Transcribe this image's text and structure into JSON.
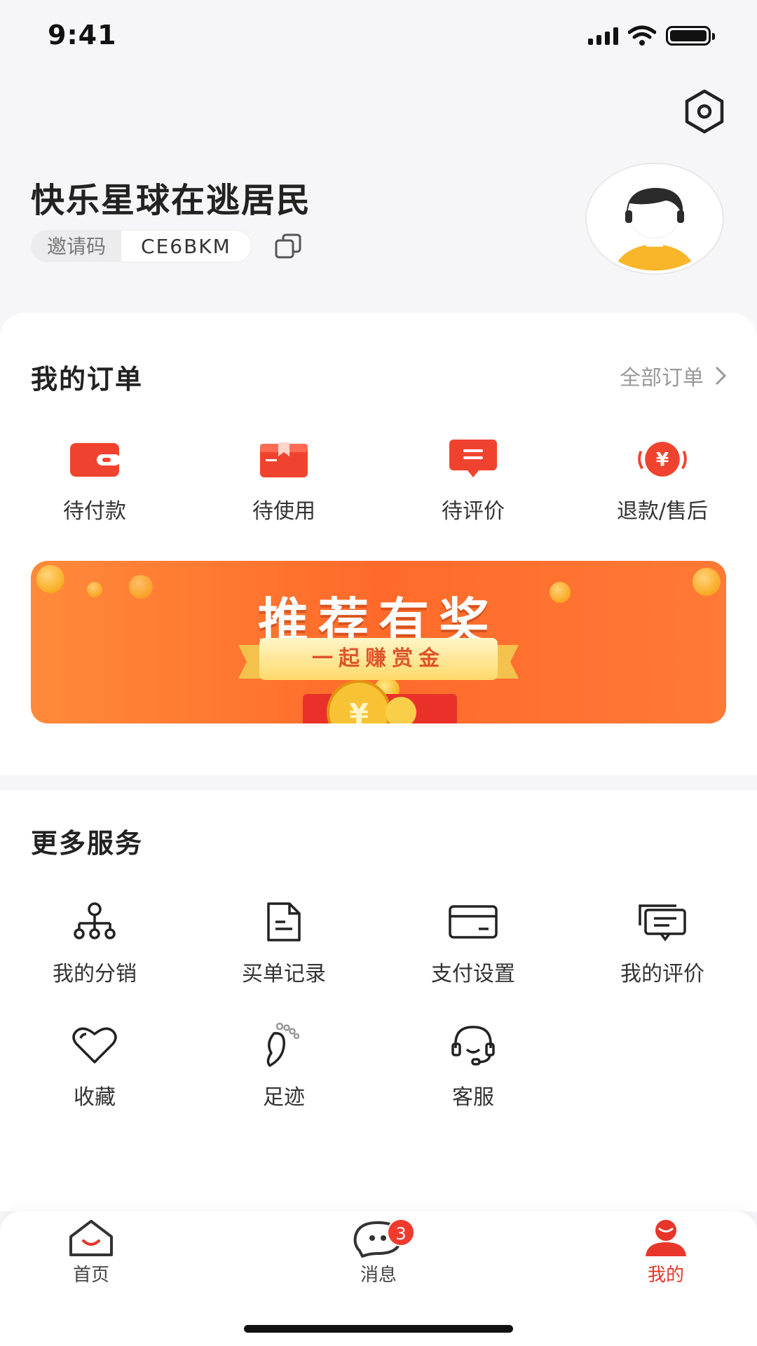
{
  "status_bar": {
    "time": "9:41"
  },
  "profile": {
    "name": "快乐星球在逃居民",
    "invite_label": "邀请码",
    "invite_code": "CE6BKM"
  },
  "orders": {
    "title": "我的订单",
    "all_label": "全部订单",
    "items": [
      {
        "label": "待付款",
        "icon": "wallet-icon"
      },
      {
        "label": "待使用",
        "icon": "gift-box-icon"
      },
      {
        "label": "待评价",
        "icon": "comment-icon"
      },
      {
        "label": "退款/售后",
        "icon": "refund-icon"
      }
    ]
  },
  "banner": {
    "title": "推荐有奖",
    "subtitle": "一起赚赏金"
  },
  "services": {
    "title": "更多服务",
    "items": [
      {
        "label": "我的分销",
        "icon": "distribution-icon"
      },
      {
        "label": "买单记录",
        "icon": "document-icon"
      },
      {
        "label": "支付设置",
        "icon": "card-icon"
      },
      {
        "label": "我的评价",
        "icon": "reviews-icon"
      },
      {
        "label": "收藏",
        "icon": "heart-icon"
      },
      {
        "label": "足迹",
        "icon": "footprint-icon"
      },
      {
        "label": "客服",
        "icon": "headset-icon"
      }
    ]
  },
  "tabbar": {
    "items": [
      {
        "label": "首页",
        "icon": "home-icon"
      },
      {
        "label": "消息",
        "icon": "message-icon",
        "badge": "3"
      },
      {
        "label": "我的",
        "icon": "profile-icon"
      }
    ],
    "active_color": "#e8362b"
  },
  "colors": {
    "accent": "#e8362b",
    "banner": "#ff6a2a"
  }
}
